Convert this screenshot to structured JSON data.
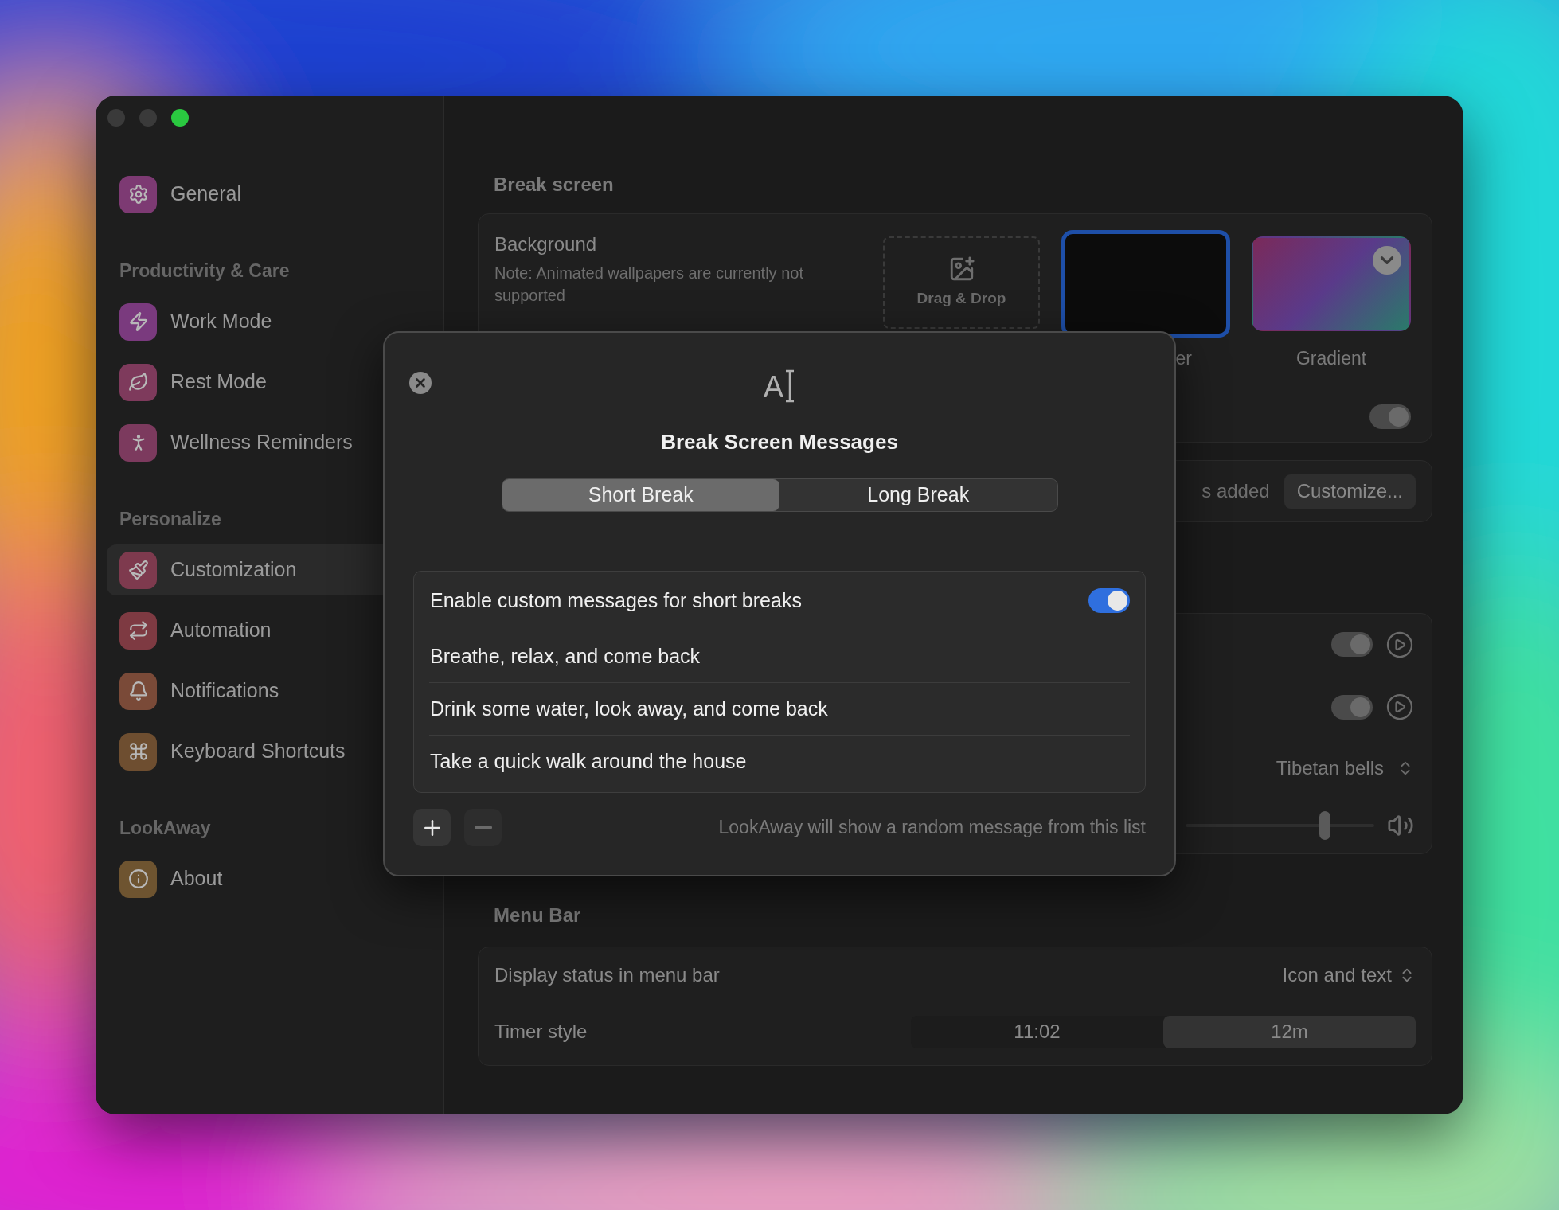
{
  "sidebar": {
    "sections": [
      {
        "items": [
          {
            "label": "General",
            "color": "#7d3a73",
            "selected": false
          }
        ]
      },
      {
        "heading": "Productivity & Care",
        "items": [
          {
            "label": "Work Mode",
            "color": "#7a3a7e",
            "selected": false
          },
          {
            "label": "Rest Mode",
            "color": "#7e3a5c",
            "selected": false
          },
          {
            "label": "Wellness Reminders",
            "color": "#7c3a5e",
            "selected": false
          }
        ]
      },
      {
        "heading": "Personalize",
        "items": [
          {
            "label": "Customization",
            "color": "#7e3a4e",
            "selected": true
          },
          {
            "label": "Automation",
            "color": "#7e3a42",
            "selected": false
          },
          {
            "label": "Notifications",
            "color": "#7a4a38",
            "selected": false
          },
          {
            "label": "Keyboard Shortcuts",
            "color": "#6e4e30",
            "selected": false
          }
        ]
      },
      {
        "heading": "LookAway",
        "items": [
          {
            "label": "About",
            "color": "#6e5430",
            "selected": false
          }
        ]
      }
    ]
  },
  "break_screen": {
    "heading": "Break screen",
    "background": {
      "label": "Background",
      "note": "Note: Animated wallpapers are currently not supported",
      "drop_zone": "Drag & Drop",
      "tiles": [
        {
          "kind": "solid",
          "label": "er",
          "selected": true
        },
        {
          "kind": "gradient",
          "label": "Gradient",
          "selected": false
        }
      ]
    },
    "background_toggle": {
      "on": true
    },
    "messages_row": {
      "text": "s added",
      "button": "Customize..."
    },
    "sound_rows": [
      {
        "kind": "toggle",
        "on": true
      },
      {
        "kind": "toggle",
        "on": true
      },
      {
        "kind": "select",
        "value": "Tibetan bells"
      },
      {
        "kind": "slider",
        "level": 0.74
      }
    ]
  },
  "menu_bar": {
    "heading": "Menu Bar",
    "rows": [
      {
        "kind": "select",
        "label": "Display status in menu bar",
        "value": "Icon and text"
      },
      {
        "kind": "segmented",
        "label": "Timer style",
        "options": [
          {
            "label": "11:02",
            "selected": false
          },
          {
            "label": "12m",
            "selected": true
          }
        ]
      }
    ]
  },
  "dialog": {
    "icon_glyph": "A",
    "title": "Break Screen Messages",
    "tabs": [
      {
        "label": "Short Break",
        "selected": true
      },
      {
        "label": "Long Break",
        "selected": false
      }
    ],
    "enable": {
      "label": "Enable custom messages for short breaks",
      "on": true
    },
    "messages": [
      "Breathe, relax, and come back",
      "Drink some water, look away, and come back",
      "Take a quick walk around the house"
    ],
    "footer_note": "LookAway will show a random message from this list"
  }
}
